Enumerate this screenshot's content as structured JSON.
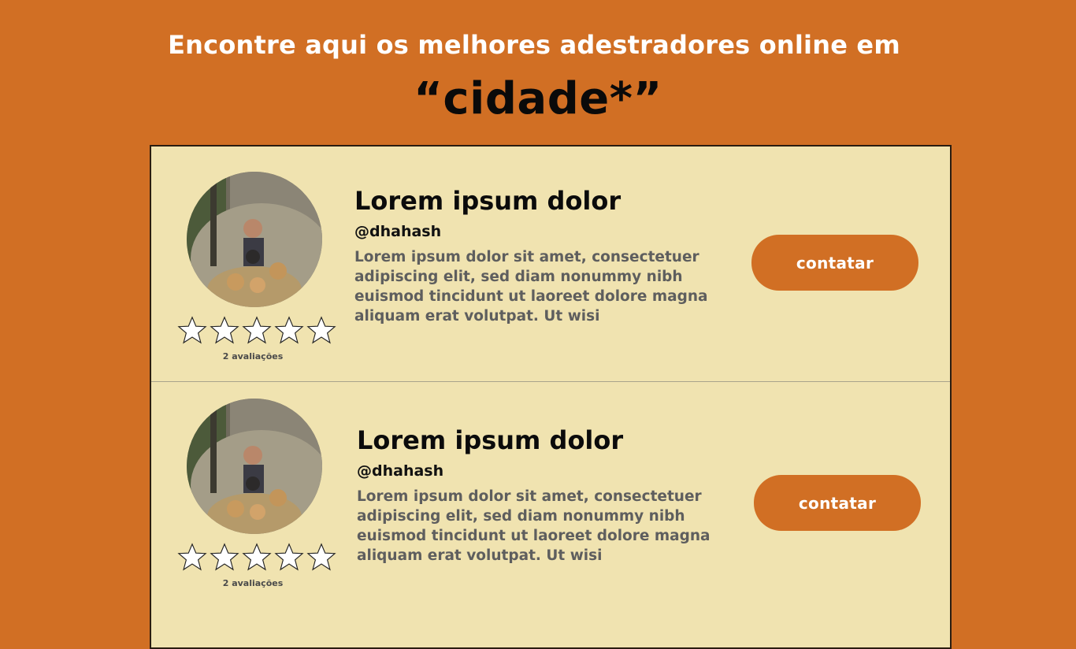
{
  "header": {
    "title": "Encontre aqui os melhores adestradores online em",
    "city": "“cidade*”"
  },
  "colors": {
    "background": "#d16f24",
    "panel": "#f0e3b0",
    "button": "#d16f24",
    "button_text": "#ffffff"
  },
  "trainers": [
    {
      "name": "Lorem ipsum dolor",
      "handle": "@dhahash",
      "description": "Lorem ipsum dolor sit amet, consectetuer adipiscing elit, sed diam nonummy nibh euismod tincidunt ut laoreet dolore magna aliquam erat volutpat. Ut wisi",
      "rating": 0,
      "reviews": "2 avaliações",
      "button_label": "contatar",
      "avatar_icon": "avatar-photo"
    },
    {
      "name": "Lorem ipsum dolor",
      "handle": "@dhahash",
      "description": "Lorem ipsum dolor sit amet, consectetuer adipiscing elit, sed diam nonummy nibh euismod tincidunt ut laoreet dolore magna aliquam erat volutpat. Ut wisi",
      "rating": 0,
      "reviews": "2 avaliações",
      "button_label": "contatar",
      "avatar_icon": "avatar-photo"
    }
  ]
}
